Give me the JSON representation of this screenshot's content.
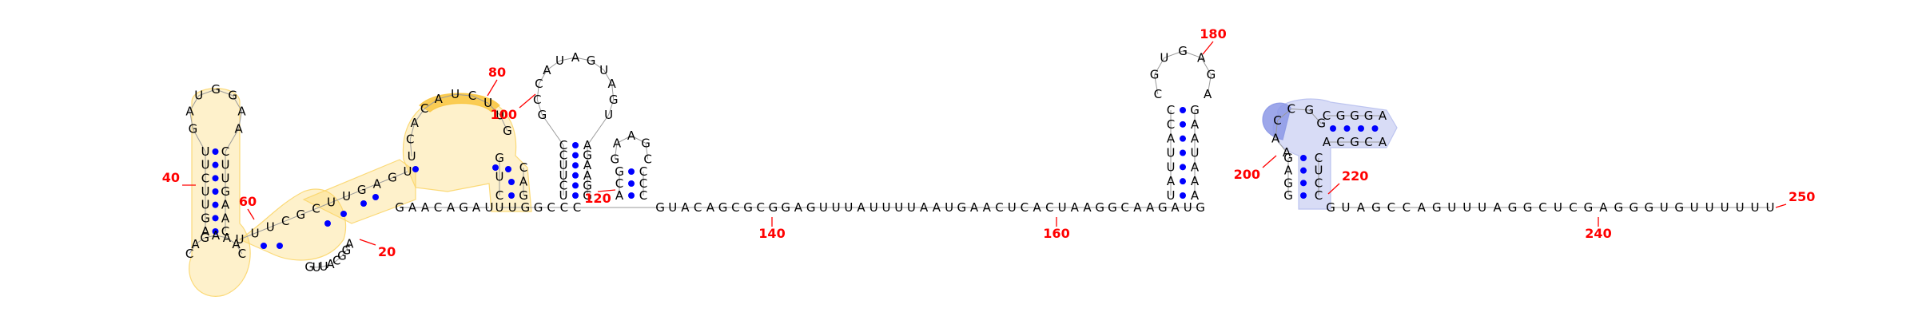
{
  "colors": {
    "pair_dot": "#0000ff",
    "position_label": "#ff0000",
    "highlight_orange": "#fbd66b",
    "highlight_orange_strong": "#f9c640",
    "highlight_blue": "#b8c0ee",
    "highlight_blue_strong": "#8c98e6"
  },
  "position_labels": [
    "20",
    "40",
    "60",
    "80",
    "100",
    "120",
    "140",
    "160",
    "180",
    "200",
    "220",
    "240",
    "250"
  ],
  "tail_sequence": "GUACAGCGCGGAGUUUAUUUUAAUGAACUCACUAAGGCAAGAUG",
  "end_tail_sequence": "GUAGCCAGUUUAGGCUCGAGGGUGUUUUUU",
  "hairpin_180_loop": "CGUGAGA",
  "hairpin_180_stem_5": "UAUUACC",
  "hairpin_180_stem_3": "AAAUAAG",
  "hairpin_100_loop": "GCCAUAGUAGU",
  "hairpin_100_stem_5": "UCUUCC",
  "hairpin_100_stem_3": "GGAAGA",
  "hairpin_120_loop": "GAAGC",
  "hairpin_120_stem_5": "ACG",
  "hairpin_120_stem_3": "CCC",
  "pseudoknot_stem_5": "GGAG",
  "pseudoknot_stem_3": "CCUC",
  "pseudoknot_loop": "AACCGGGAA",
  "pseudoknot_inner": "ACGC",
  "left_domain_loop": "GAUGGAA",
  "left_domain_stem": "UUCUUGAAC",
  "left_domain_bottom": "CAGAAAC",
  "left_domain_inner": "GUUACGGA",
  "left_domain_middle": "UUUCGCUUGAGU",
  "left_domain_top": "UCACAUCUUG",
  "left_domain_start": "GAACAGAU"
}
